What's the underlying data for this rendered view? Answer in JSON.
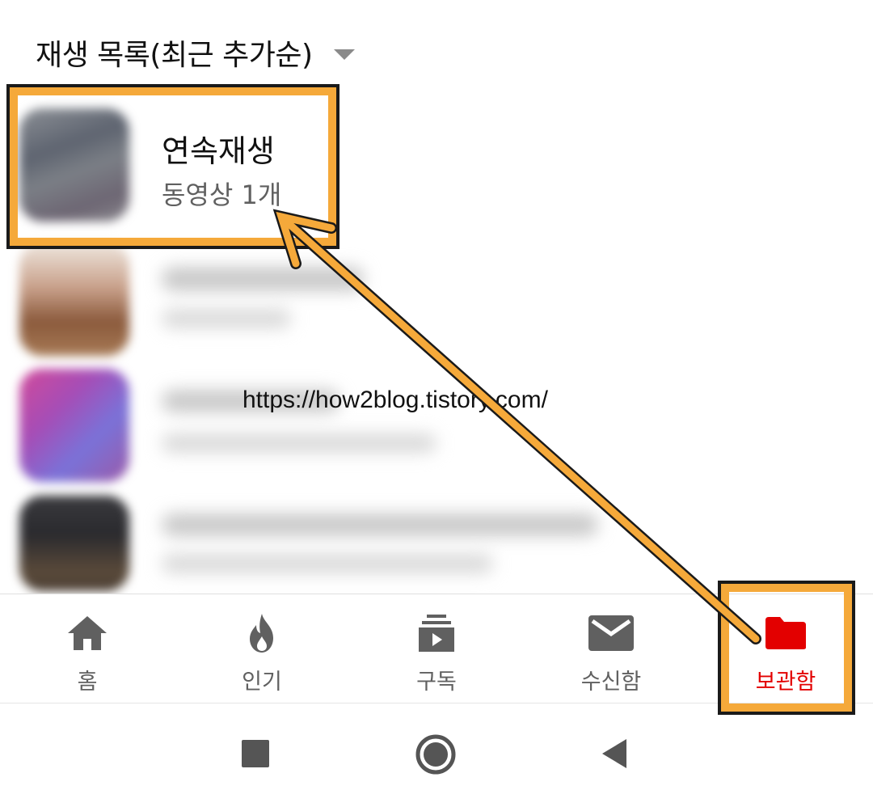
{
  "header": {
    "title": "재생 목록(최근 추가순)",
    "caret_icon": "dropdown-triangle-icon"
  },
  "playlists": [
    {
      "title": "연속재생",
      "subtitle": "동영상 1개"
    }
  ],
  "watermark": "https://how2blog.tistory.com/",
  "bottom_nav": {
    "items": [
      {
        "label": "홈",
        "icon": "home-icon"
      },
      {
        "label": "인기",
        "icon": "flame-icon"
      },
      {
        "label": "구독",
        "icon": "subscriptions-icon"
      },
      {
        "label": "수신함",
        "icon": "mail-icon"
      },
      {
        "label": "보관함",
        "icon": "folder-icon",
        "active": true
      }
    ],
    "active_color": "#e30000",
    "inactive_color": "#606060"
  },
  "system_nav": {
    "icons": [
      "recents-square-icon",
      "home-circle-icon",
      "back-triangle-icon"
    ]
  },
  "annotation": {
    "color": "#f5a93a"
  }
}
